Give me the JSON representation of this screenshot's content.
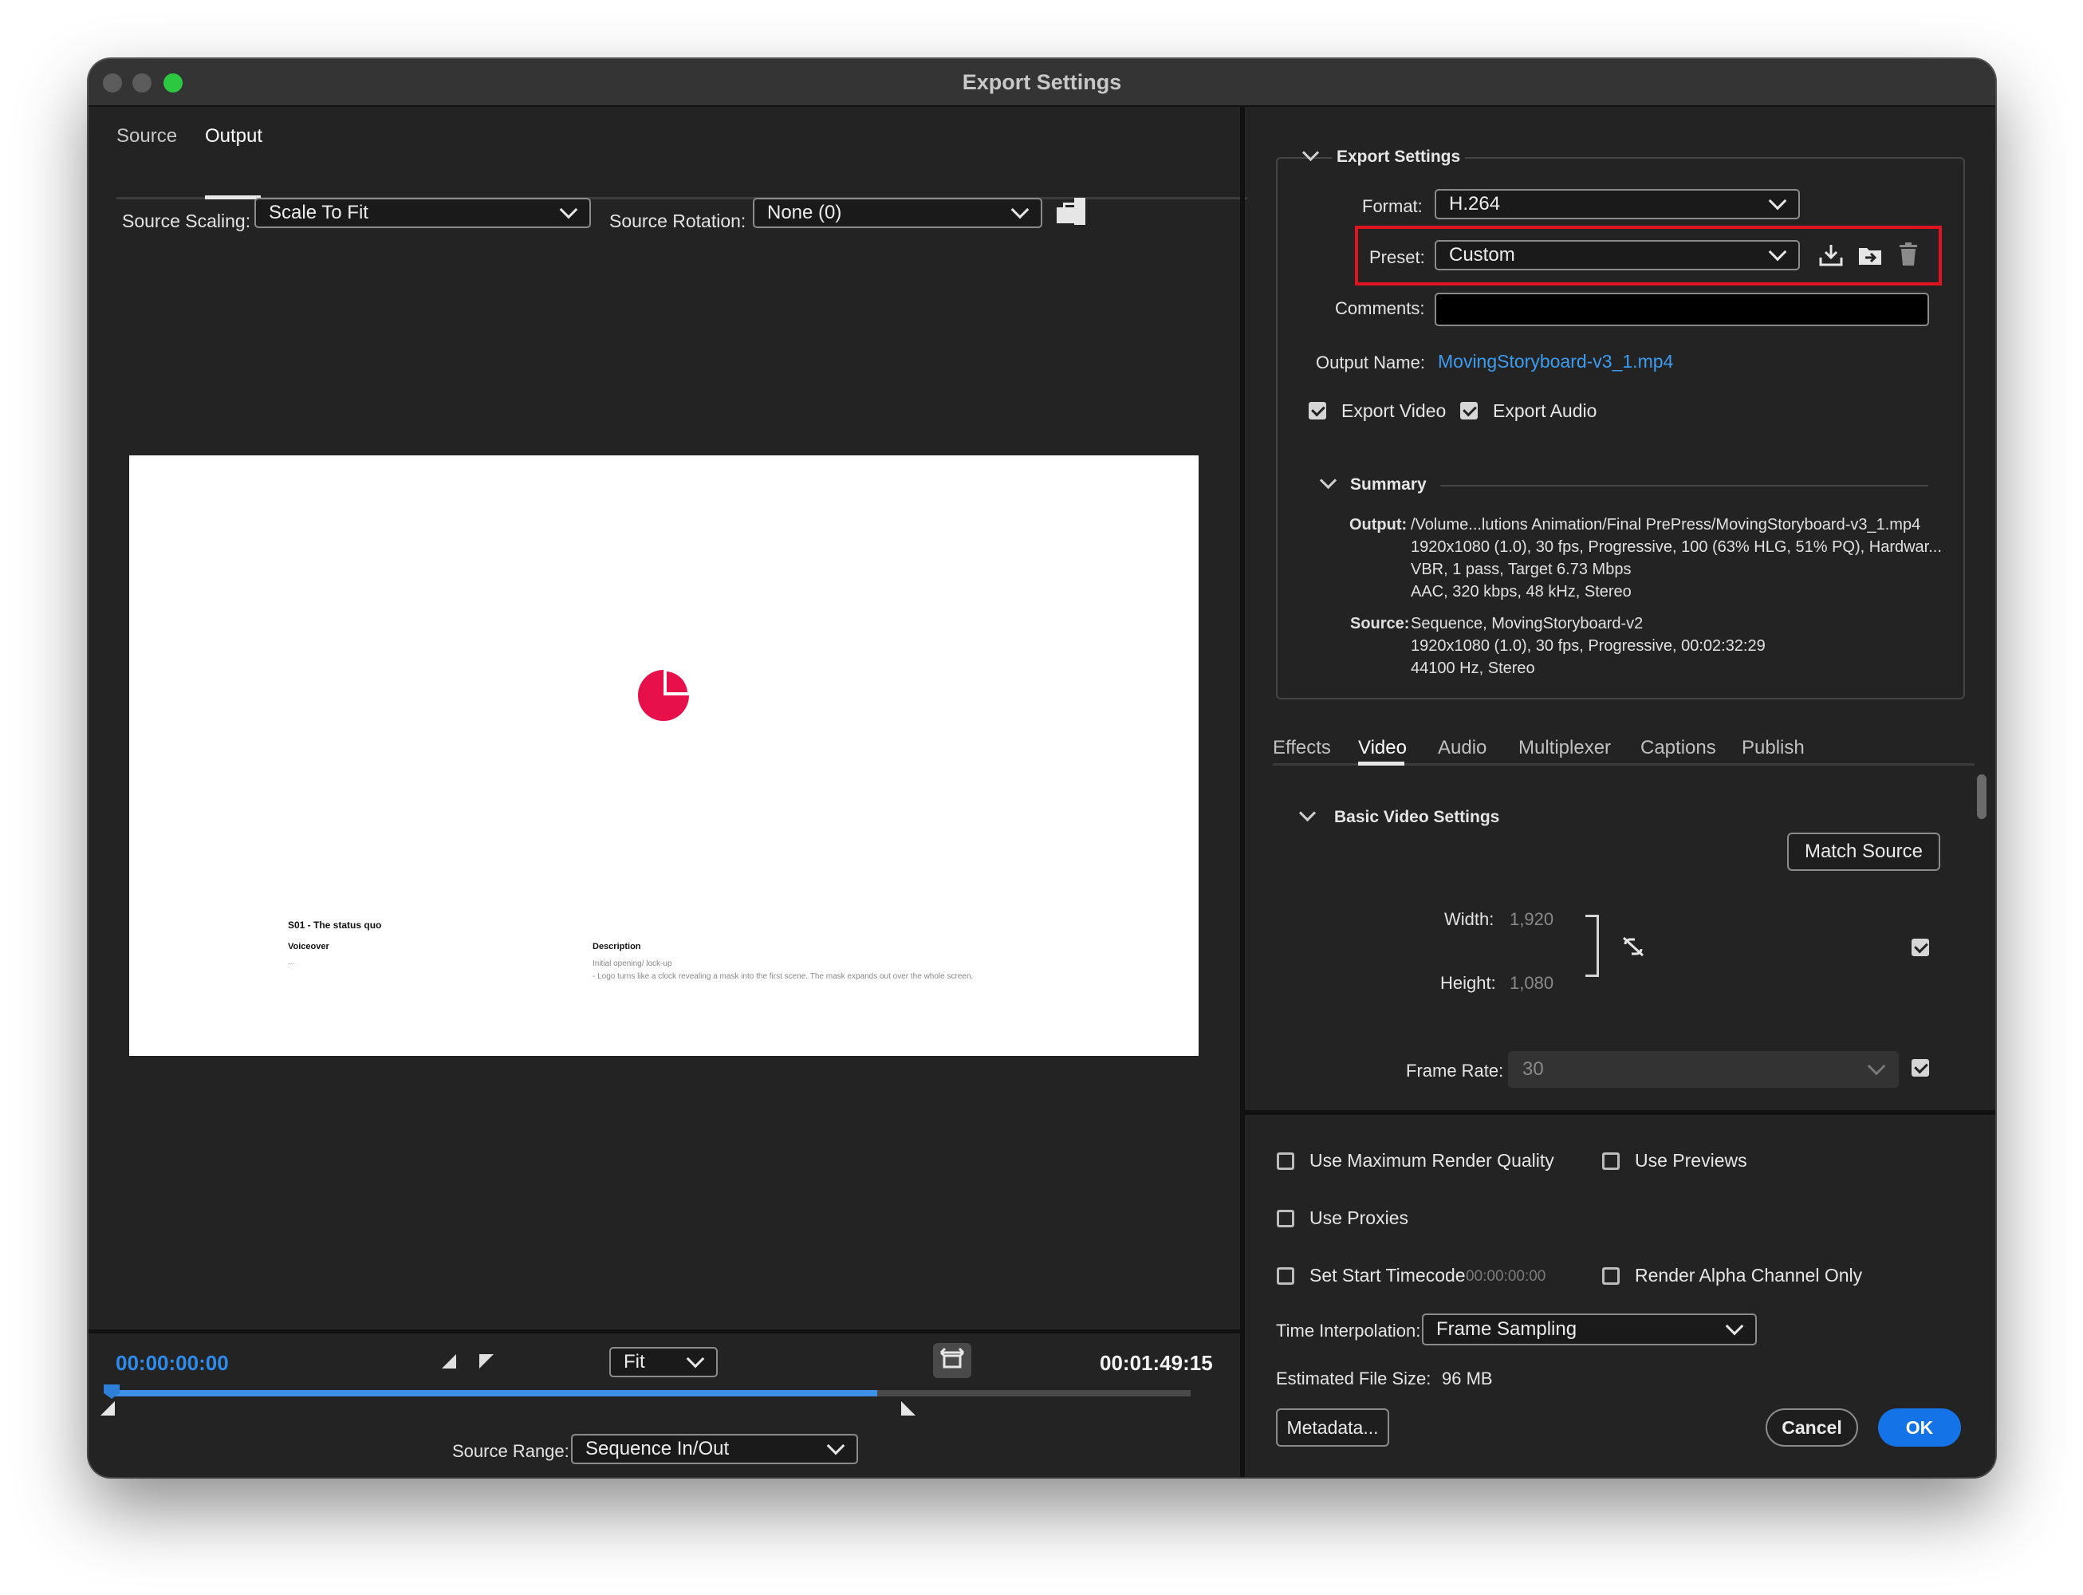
{
  "window": {
    "title": "Export Settings"
  },
  "left": {
    "tabs": {
      "source": "Source",
      "output": "Output"
    },
    "source_scaling": {
      "label": "Source Scaling:",
      "value": "Scale To Fit"
    },
    "source_rotation": {
      "label": "Source Rotation:",
      "value": "None (0)"
    },
    "preview": {
      "scene_title": "S01 - The status quo",
      "voiceover_label": "Voiceover",
      "voiceover_text": "...",
      "description_label": "Description",
      "description_line1": "Initial opening/ lock-up",
      "description_line2": "- Logo turns like a clock revealing  a mask into the first scene. The mask expands out over the whole screen.",
      "logo_color": "#e8104a"
    },
    "timeline": {
      "current_time": "00:00:00:00",
      "end_time": "00:01:49:15",
      "zoom": "Fit",
      "source_range_label": "Source Range:",
      "source_range_value": "Sequence In/Out",
      "progress_fraction": 0.71
    }
  },
  "export_settings": {
    "section_title": "Export Settings",
    "format_label": "Format:",
    "format_value": "H.264",
    "preset_label": "Preset:",
    "preset_value": "Custom",
    "comments_label": "Comments:",
    "comments_value": "",
    "output_name_label": "Output Name:",
    "output_name_value": "MovingStoryboard-v3_1.mp4",
    "export_video_label": "Export Video",
    "export_audio_label": "Export Audio",
    "highlight_color": "#e0141e"
  },
  "summary": {
    "title": "Summary",
    "output_label": "Output:",
    "output_lines": [
      "/Volume...lutions Animation/Final PrePress/MovingStoryboard-v3_1.mp4",
      "1920x1080 (1.0), 30 fps, Progressive, 100 (63% HLG, 51% PQ), Hardwar...",
      "VBR, 1 pass, Target 6.73 Mbps",
      "AAC, 320 kbps, 48 kHz, Stereo"
    ],
    "source_label": "Source:",
    "source_lines": [
      "Sequence, MovingStoryboard-v2",
      "1920x1080 (1.0), 30 fps, Progressive, 00:02:32:29",
      "44100 Hz, Stereo"
    ]
  },
  "settings_tabs": [
    "Effects",
    "Video",
    "Audio",
    "Multiplexer",
    "Captions",
    "Publish"
  ],
  "active_settings_tab": "Video",
  "video": {
    "section_title": "Basic Video Settings",
    "match_source": "Match Source",
    "width_label": "Width:",
    "width_value": "1,920",
    "height_label": "Height:",
    "height_value": "1,080",
    "frame_rate_label": "Frame Rate:",
    "frame_rate_value": "30"
  },
  "bottom": {
    "use_max_render_quality": "Use Maximum Render Quality",
    "use_previews": "Use Previews",
    "use_proxies": "Use Proxies",
    "set_start_timecode": "Set Start Timecode",
    "start_timecode_value": "00:00:00:00",
    "render_alpha": "Render Alpha Channel Only",
    "time_interpolation_label": "Time Interpolation:",
    "time_interpolation_value": "Frame Sampling",
    "estimated_file_size_label": "Estimated File Size:",
    "estimated_file_size_value": "96 MB",
    "metadata_button": "Metadata...",
    "cancel_button": "Cancel",
    "ok_button": "OK",
    "accent_color": "#1473e6"
  }
}
